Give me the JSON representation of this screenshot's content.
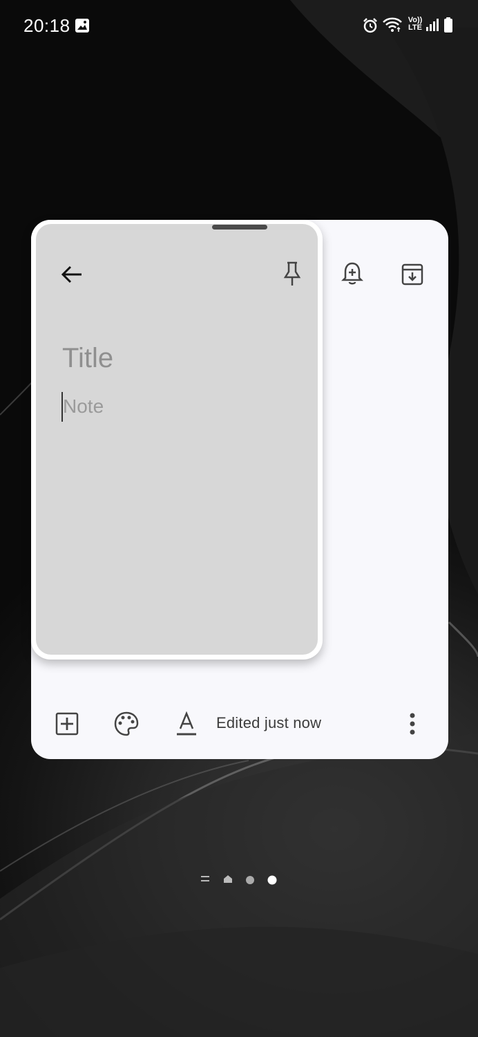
{
  "status_bar": {
    "time": "20:18",
    "left_icons": [
      "gallery-icon"
    ],
    "right_icons": [
      "alarm-icon",
      "wifi-icon",
      "volte-icon",
      "signal-icon",
      "battery-icon"
    ],
    "volte_label_top": "Vo))",
    "volte_label_bottom": "LTE"
  },
  "note_editor": {
    "title_placeholder": "Title",
    "note_placeholder": "Note",
    "toolbar_top": [
      "back-arrow-icon",
      "pin-icon",
      "reminder-bell-icon",
      "archive-icon"
    ],
    "toolbar_bottom": [
      "add-box-icon",
      "palette-icon",
      "text-format-icon",
      "more-vert-icon"
    ],
    "edited_status": "Edited just now"
  },
  "page_indicator": {
    "items": [
      "menu",
      "home",
      "page",
      "page-active"
    ]
  },
  "colors": {
    "card_background": "#f8f8fc",
    "overlay_background": "#d7d7d7",
    "placeholder_text": "#8f8f8f"
  }
}
